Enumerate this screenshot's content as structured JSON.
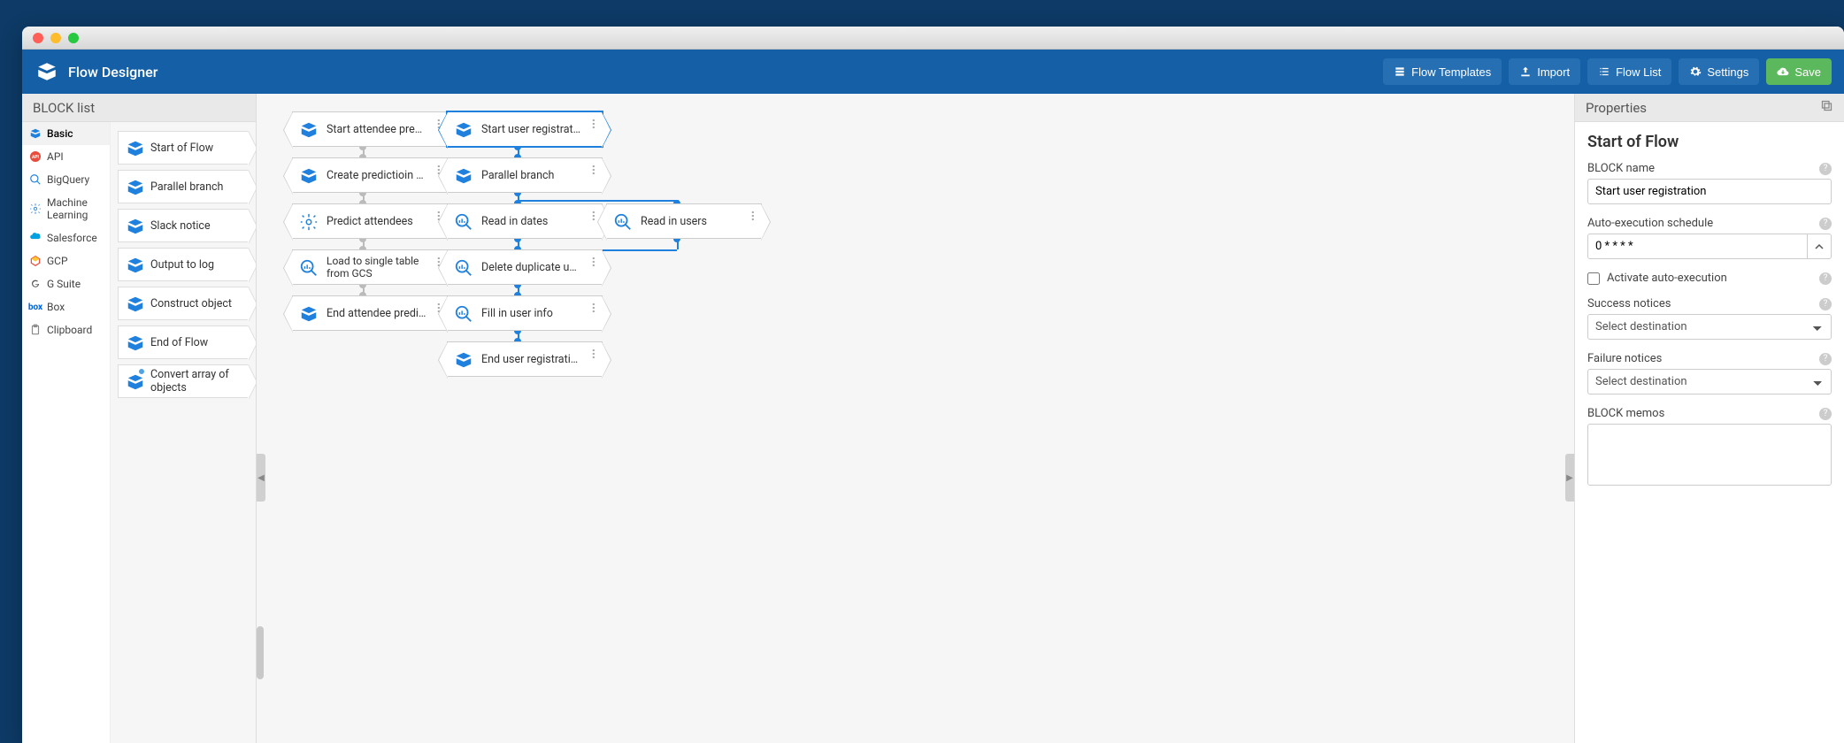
{
  "app": {
    "title": "Flow Designer"
  },
  "header_buttons": {
    "templates": "Flow Templates",
    "import": "Import",
    "flowlist": "Flow List",
    "settings": "Settings",
    "save": "Save"
  },
  "left_panel": {
    "title": "BLOCK list",
    "categories": [
      "Basic",
      "API",
      "BigQuery",
      "Machine Learning",
      "Salesforce",
      "GCP",
      "G Suite",
      "Box",
      "Clipboard"
    ],
    "active_category": "Basic",
    "blocks": [
      "Start of Flow",
      "Parallel branch",
      "Slack notice",
      "Output to log",
      "Construct object",
      "End of Flow",
      "Convert array of objects"
    ]
  },
  "canvas": {
    "col_a": [
      {
        "label": "Start attendee prediction",
        "icon": "box"
      },
      {
        "label": "Create predictioin data",
        "icon": "box"
      },
      {
        "label": "Predict attendees",
        "icon": "ml"
      },
      {
        "label": "Load to single table from GCS",
        "icon": "bq",
        "multiline": true
      },
      {
        "label": "End attendee prediction",
        "icon": "box"
      }
    ],
    "col_b": [
      {
        "label": "Start user registration",
        "icon": "box",
        "selected": true
      },
      {
        "label": "Parallel branch",
        "icon": "box"
      },
      {
        "label": "Read in dates",
        "icon": "bq"
      },
      {
        "label": "Delete duplicate users",
        "icon": "bq"
      },
      {
        "label": "Fill in user info",
        "icon": "bq"
      },
      {
        "label": "End user registration",
        "icon": "box"
      }
    ],
    "col_c": [
      {
        "label": "Read in users",
        "icon": "bq"
      }
    ]
  },
  "right_panel": {
    "title": "Properties",
    "heading": "Start of Flow",
    "labels": {
      "block_name": "BLOCK name",
      "schedule": "Auto-execution schedule",
      "activate": "Activate auto-execution",
      "success": "Success notices",
      "failure": "Failure notices",
      "memos": "BLOCK memos",
      "select_placeholder": "Select destination"
    },
    "values": {
      "block_name": "Start user registration",
      "schedule": "0 * * * *",
      "activate": false
    }
  }
}
